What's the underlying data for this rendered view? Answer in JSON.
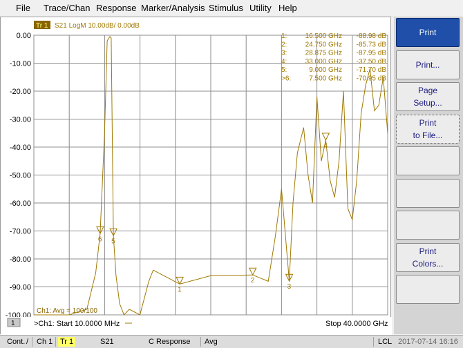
{
  "menu": [
    "File",
    "Trace/Chan",
    "Response",
    "Marker/Analysis",
    "Stimulus",
    "Utility",
    "Help"
  ],
  "trace": {
    "tag": "Tr 1",
    "label": "S21 LogM 10.00dB/  0.00dB",
    "color": "#a07800"
  },
  "channel": {
    "number_box": "1",
    "start_text": ">Ch1:  Start  10.0000 MHz",
    "stop_text": "Stop  40.0000 GHz",
    "overlay_text": "Ch1: Avg =  100/100"
  },
  "markers": [
    {
      "num": "1:",
      "freq": "16.500 GHz",
      "val": "-88.98 dB"
    },
    {
      "num": "2:",
      "freq": "24.750 GHz",
      "val": "-85.73 dB"
    },
    {
      "num": "3:",
      "freq": "28.875 GHz",
      "val": "-87.95 dB"
    },
    {
      "num": "4:",
      "freq": "33.000 GHz",
      "val": "-37.50 dB"
    },
    {
      "num": "5:",
      "freq": "9.000 GHz",
      "val": "-71.70 dB"
    },
    {
      "num": ">6:",
      "freq": "7.500 GHz",
      "val": "-70.95 dB"
    }
  ],
  "softkeys": [
    {
      "lines": [
        "Print"
      ],
      "active": true
    },
    {
      "lines": [
        "Print..."
      ],
      "active": false
    },
    {
      "lines": [
        "Page",
        "Setup..."
      ],
      "active": false
    },
    {
      "lines": [
        "Print",
        "to File..."
      ],
      "active": false,
      "dotted": true
    },
    {
      "lines": [
        ""
      ],
      "active": false
    },
    {
      "lines": [
        ""
      ],
      "active": false
    },
    {
      "lines": [
        ""
      ],
      "active": false
    },
    {
      "lines": [
        "Print",
        "Colors..."
      ],
      "active": false
    },
    {
      "lines": [
        ""
      ],
      "active": false
    }
  ],
  "statusbar": {
    "mode": "Cont.",
    "channel": "Ch 1",
    "trace": "Tr 1",
    "param": "S21",
    "correction": "C  Response",
    "avg": "Avg",
    "lcl": "LCL",
    "datetime": "2017-07-14 16:16"
  },
  "chart_data": {
    "type": "line",
    "x_range_ghz": [
      0.01,
      40.0
    ],
    "ylim": [
      -100,
      0
    ],
    "y_ticks": [
      "0.00",
      "-10.00",
      "-20.00",
      "-30.00",
      "-40.00",
      "-50.00",
      "-60.00",
      "-70.00",
      "-80.00",
      "-90.00",
      "-100.00"
    ],
    "grid": true,
    "series": [
      {
        "x": [
          0.01,
          2.0,
          4.0,
          6.0,
          7.0,
          7.5,
          8.0,
          8.3,
          8.6,
          8.75,
          9.0,
          9.3,
          9.7,
          10.2,
          10.8,
          12.0,
          13.0,
          13.5,
          16.5,
          20.0,
          24.75,
          26.5,
          27.3,
          28.0,
          28.875,
          29.3,
          29.8,
          30.5,
          31.0,
          31.5,
          32.0,
          32.5,
          33.0,
          33.5,
          34.0,
          34.5,
          35.0,
          35.5,
          36.0,
          36.5,
          37.0,
          37.5,
          38.0,
          38.5,
          39.0,
          39.5,
          40.0
        ],
        "y": [
          -100,
          -100,
          -100,
          -98,
          -85,
          -70.95,
          -35,
          -2,
          -0.5,
          -1,
          -71.7,
          -86,
          -96,
          -100,
          -98,
          -100,
          -88,
          -84,
          -88.98,
          -86,
          -85.73,
          -88,
          -72,
          -55,
          -87.95,
          -60,
          -42,
          -33,
          -50,
          -60,
          -22,
          -45,
          -37.5,
          -52,
          -58,
          -45,
          -20,
          -62,
          -66,
          -52,
          -28,
          -18,
          -12,
          -27,
          -25,
          -15,
          -35
        ]
      }
    ]
  }
}
